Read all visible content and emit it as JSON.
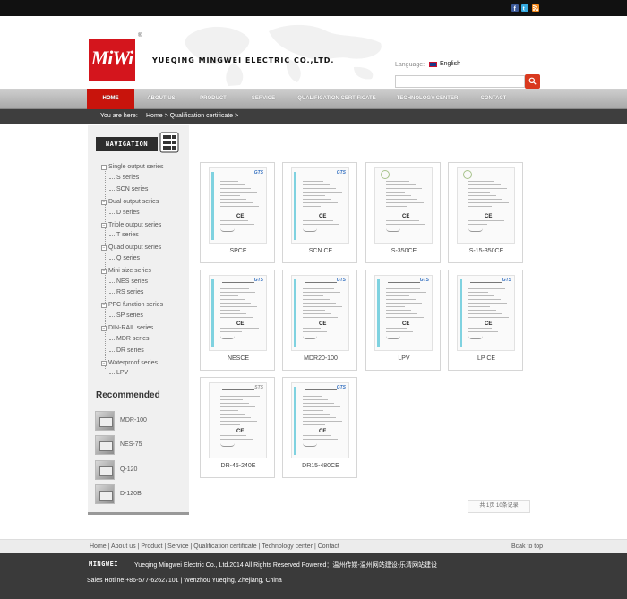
{
  "colors": {
    "brand_red": "#c8140c",
    "search_orange": "#d9391e",
    "topbar": "#111111",
    "crumbbar": "#3e3e3e",
    "footer": "#3a3a3a"
  },
  "social": [
    {
      "icon": "facebook-icon"
    },
    {
      "icon": "twitter-icon"
    },
    {
      "icon": "rss-icon"
    }
  ],
  "header": {
    "logo_text": "MiWi",
    "logo_reg": "®",
    "company_name": "YUEQING MINGWEI ELECTRIC CO.,LTD.",
    "language_label": "Language:",
    "language_value": "English",
    "search": {
      "value": "",
      "placeholder": ""
    }
  },
  "nav": {
    "items": [
      {
        "label": "HOME",
        "active": true
      },
      {
        "label": "ABOUT US"
      },
      {
        "label": "PRODUCT"
      },
      {
        "label": "SERVICE"
      },
      {
        "label": "QUALIFICATION CERTIFICATE"
      },
      {
        "label": "TECHNOLOGY CENTER"
      },
      {
        "label": "CONTACT"
      }
    ]
  },
  "breadcrumb": {
    "label": "You are here:",
    "path": "Home > Qualification certificate >"
  },
  "sidebar": {
    "heading": "NAVIGATION",
    "groups": [
      {
        "label": "Single output series",
        "children": [
          "S series",
          "SCN series"
        ]
      },
      {
        "label": "Dual output series",
        "children": [
          "D series"
        ]
      },
      {
        "label": "Triple output series",
        "children": [
          "T series"
        ]
      },
      {
        "label": "Quad output series",
        "children": [
          "Q series"
        ]
      },
      {
        "label": "Mini size series",
        "children": [
          "NES series",
          "RS series"
        ]
      },
      {
        "label": "PFC function series",
        "children": [
          "SP series"
        ]
      },
      {
        "label": "DIN-RAIL series",
        "children": [
          "MDR series",
          "DR series"
        ]
      },
      {
        "label": "Waterproof series",
        "children": [
          "LPV"
        ]
      }
    ],
    "recommended_title": "Recommended",
    "recommended": [
      "MDR-100",
      "NES-75",
      "Q-120",
      "D-120B"
    ]
  },
  "certificates": [
    {
      "label": "SPCE",
      "type": "gts"
    },
    {
      "label": "SCN CE",
      "type": "gts"
    },
    {
      "label": "S-350CE",
      "type": "emc"
    },
    {
      "label": "S-15-350CE",
      "type": "emc"
    },
    {
      "label": "NESCE",
      "type": "gts"
    },
    {
      "label": "MDR20-100",
      "type": "gts"
    },
    {
      "label": "LPV",
      "type": "gts"
    },
    {
      "label": "LP CE",
      "type": "gts"
    },
    {
      "label": "DR-45-240E",
      "type": "sts"
    },
    {
      "label": "DR15-480CE",
      "type": "gts"
    }
  ],
  "pager": {
    "text": "共 1页 10条记录"
  },
  "footer": {
    "links": "Home | About us | Product | Service | Qualification certificate | Technology center | Contact",
    "back_to_top": "Bcak to top",
    "brand": "MINGWEI",
    "copyright": "Yueqing Mingwei Electric Co., Ltd.2014 All Rights Reserved    Powered：温州传媒-温州网站建设-乐清网站建设",
    "contact": "Sales Hotline:+86-577-62627101  |  Wenzhou Yueqing, Zhejiang, China"
  }
}
